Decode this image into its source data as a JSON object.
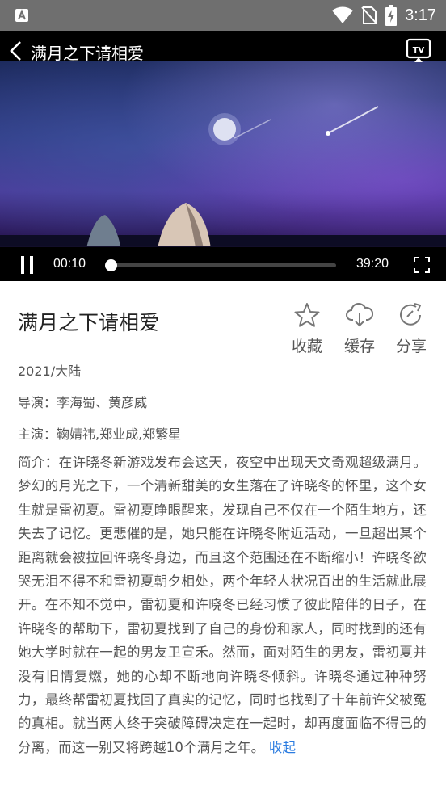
{
  "status_bar": {
    "time": "3:17",
    "icons": [
      "app-notification-icon",
      "wifi-icon",
      "no-sim-icon",
      "battery-charging-icon"
    ]
  },
  "player": {
    "title": "满月之下请相爱",
    "current_time": "00:10",
    "duration": "39:20",
    "progress_fraction": 0.004,
    "icons": [
      "back-icon",
      "tv-cast-icon",
      "pause-icon",
      "fullscreen-icon"
    ]
  },
  "info": {
    "title": "满月之下请相爱",
    "actions": [
      {
        "label": "收藏",
        "icon": "star-icon"
      },
      {
        "label": "缓存",
        "icon": "cloud-download-icon"
      },
      {
        "label": "分享",
        "icon": "share-icon"
      }
    ],
    "year_region": "2021/大陆",
    "director": "导演：李海蜀、黄彦威",
    "cast": "主演：鞠婧祎,郑业成,郑繁星",
    "synopsis": "简介：在许晓冬新游戏发布会这天，夜空中出现天文奇观超级满月。梦幻的月光之下，一个清新甜美的女生落在了许晓冬的怀里，这个女生就是雷初夏。雷初夏睁眼醒来，发现自己不仅在一个陌生地方，还失去了记忆。更悲催的是，她只能在许晓冬附近活动，一旦超出某个距离就会被拉回许晓冬身边，而且这个范围还在不断缩小！许晓冬欲哭无泪不得不和雷初夏朝夕相处，两个年轻人状况百出的生活就此展开。在不知不觉中，雷初夏和许晓冬已经习惯了彼此陪伴的日子，在许晓冬的帮助下，雷初夏找到了自己的身份和家人，同时找到的还有她大学时就在一起的男友卫宣禾。然而，面对陌生的男友，雷初夏并没有旧情复燃，她的心却不断地向许晓冬倾斜。许晓冬通过种种努力，最终帮雷初夏找回了真实的记忆，同时也找到了十年前许父被冤的真相。就当两人终于突破障碍决定在一起时，却再度面临不得已的分离，而这一别又将跨越10个满月之年。",
    "collapse_label": "收起"
  }
}
